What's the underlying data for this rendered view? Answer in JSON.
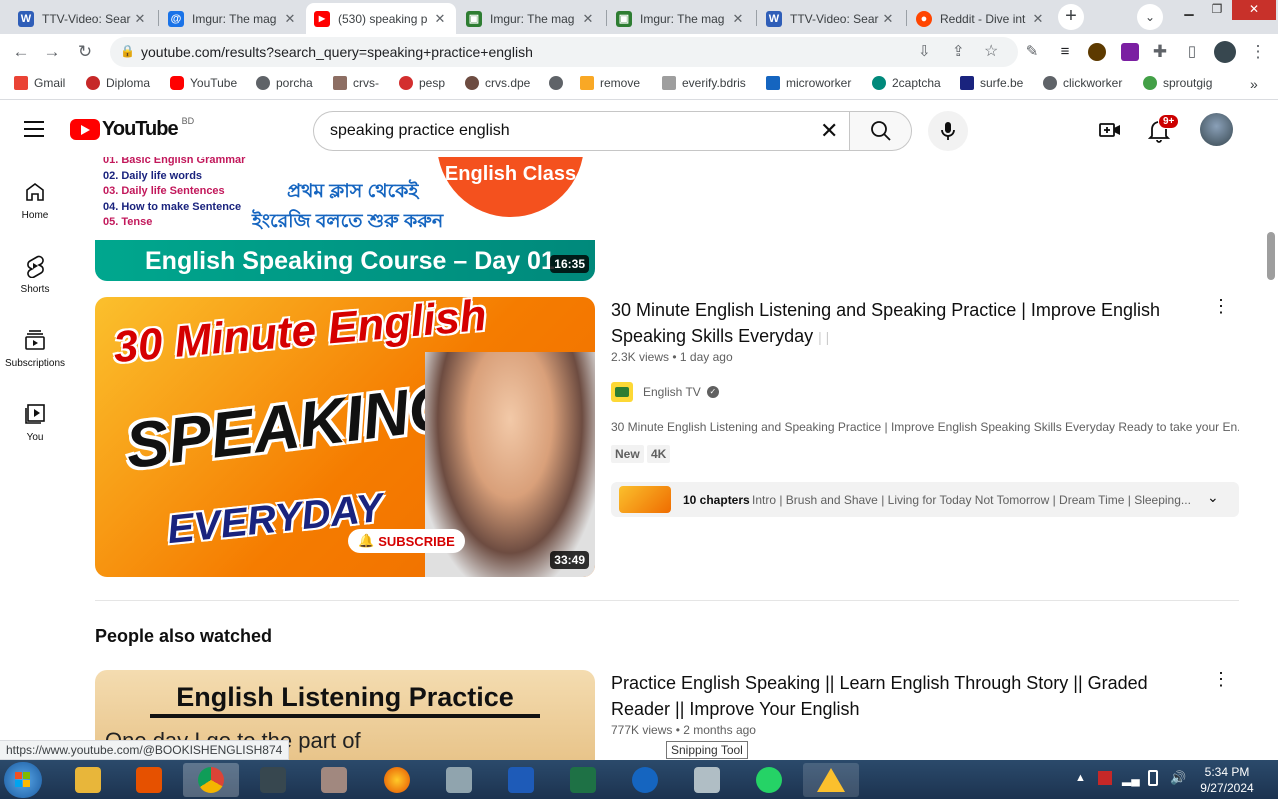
{
  "browser": {
    "tabs": [
      {
        "title": "TTV-Video: Sear",
        "favicon": "W",
        "color": "#2f5eb8",
        "active": false
      },
      {
        "title": "Imgur: The mag",
        "favicon": "@",
        "color": "#1a73e8",
        "active": false
      },
      {
        "title": "(530) speaking p",
        "favicon": "▶",
        "color": "#ff0000",
        "active": true
      },
      {
        "title": "Imgur: The mag",
        "favicon": "▣",
        "color": "#2e7d32",
        "active": false
      },
      {
        "title": "Imgur: The mag",
        "favicon": "▣",
        "color": "#2e7d32",
        "active": false
      },
      {
        "title": "TTV-Video: Sear",
        "favicon": "W",
        "color": "#2f5eb8",
        "active": false
      },
      {
        "title": "Reddit - Dive int",
        "favicon": "●",
        "color": "#ff4500",
        "active": false
      }
    ],
    "url": "youtube.com/results?search_query=speaking+practice+english",
    "bookmarks": [
      {
        "label": "Gmail",
        "color": "#ea4335"
      },
      {
        "label": "Diploma",
        "color": "#c62828"
      },
      {
        "label": "YouTube",
        "color": "#ff0000"
      },
      {
        "label": "porcha",
        "color": "#5f6368"
      },
      {
        "label": "crvs-",
        "color": "#8d6e63"
      },
      {
        "label": "pesp",
        "color": "#d32f2f"
      },
      {
        "label": "crvs.dpe",
        "color": "#6d4c41"
      },
      {
        "label": "",
        "color": "#5f6368"
      },
      {
        "label": "remove",
        "color": "#f9a825"
      },
      {
        "label": "everify.bdris",
        "color": "#9e9e9e"
      },
      {
        "label": "microworker",
        "color": "#1565c0"
      },
      {
        "label": "2captcha",
        "color": "#00897b"
      },
      {
        "label": "surfe.be",
        "color": "#1a237e"
      },
      {
        "label": "clickworker",
        "color": "#5f6368"
      },
      {
        "label": "sproutgig",
        "color": "#43a047"
      }
    ]
  },
  "youtube": {
    "logo_text": "YouTube",
    "region": "BD",
    "search_value": "speaking practice english",
    "notifications": "9+",
    "rail": [
      {
        "label": "Home"
      },
      {
        "label": "Shorts"
      },
      {
        "label": "Subscriptions"
      },
      {
        "label": "You"
      }
    ],
    "prev_video": {
      "list": [
        "01.  Basic English Grammar",
        "02.  Daily life words",
        "03.  Daily life Sentences",
        "04.  How to make Sentence",
        "05.  Tense"
      ],
      "bangla_1": "প্রথম ক্লাস থেকেই",
      "bangla_2": "ইংরেজি বলতে শুরু করুন",
      "circle": "English Class",
      "banner": "English Speaking Course – Day 01",
      "duration": "16:35"
    },
    "video1": {
      "thumb_line1": "30 Minute English",
      "thumb_line2": "SPEAKING",
      "thumb_line3": "EVERYDAY",
      "thumb_subscribe": "SUBSCRIBE",
      "duration": "33:49",
      "title_line1": "30 Minute English Listening and Speaking Practice | Improve English",
      "title_line2": "Speaking Skills Everyday",
      "views": "2.3K views",
      "age": "1 day ago",
      "channel": "English TV",
      "description": "30 Minute English Listening and Speaking Practice | Improve English Speaking Skills Everyday Ready to take your En...",
      "badges": [
        "New",
        "4K"
      ],
      "chapters_count": "10 chapters",
      "chapters_text": "Intro | Brush and Shave | Living for Today Not Tomorrow | Dream Time | Sleeping..."
    },
    "section_title": "People also watched",
    "video2": {
      "thumb_line1": "English Listening Practice",
      "thumb_line2": "One day I go to the part of",
      "title_line1": "Practice English Speaking || Learn English Through Story || Graded",
      "title_line2": "Reader || Improve Your English",
      "views": "777K views",
      "age": "2 months ago"
    },
    "status_url": "https://www.youtube.com/@BOOKISHENGLISH874",
    "tooltip": "Snipping Tool"
  },
  "taskbar": {
    "time": "5:34 PM",
    "date": "9/27/2024"
  }
}
